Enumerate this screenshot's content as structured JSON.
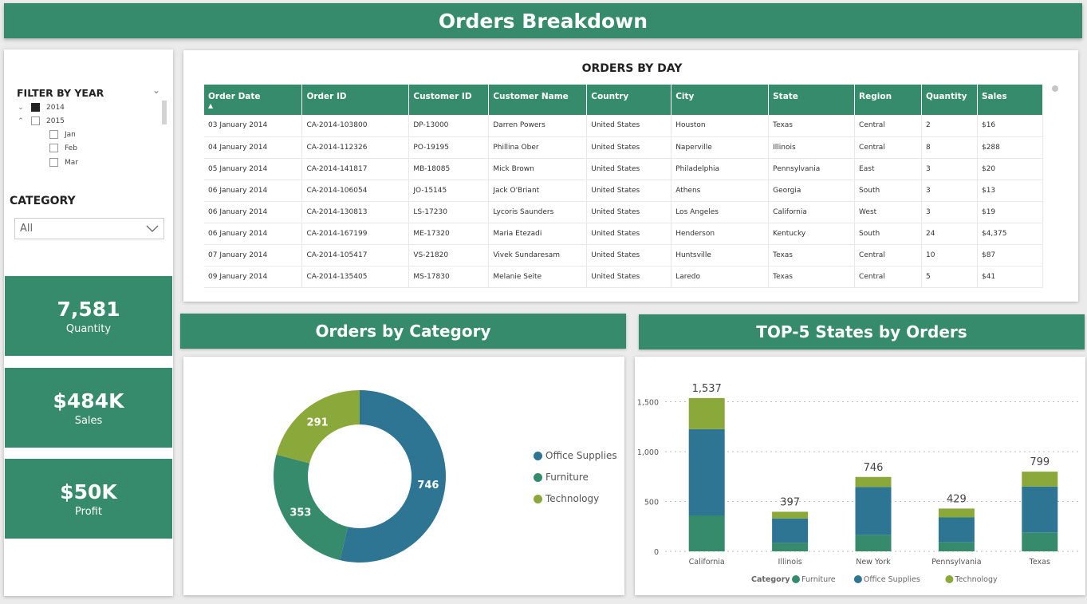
{
  "header": {
    "title": "Orders Breakdown"
  },
  "filters": {
    "year_title": "FILTER BY YEAR",
    "years": [
      {
        "label": "2014",
        "checked": true,
        "expanded": false
      },
      {
        "label": "2015",
        "checked": false,
        "expanded": true
      }
    ],
    "months": [
      "Jan",
      "Feb",
      "Mar"
    ],
    "category_title": "CATEGORY",
    "category_value": "All"
  },
  "kpis": [
    {
      "value": "7,581",
      "label": "Quantity"
    },
    {
      "value": "$484K",
      "label": "Sales"
    },
    {
      "value": "$50K",
      "label": "Profit"
    }
  ],
  "orders_table": {
    "title": "ORDERS BY DAY",
    "columns": [
      "Order Date",
      "Order ID",
      "Customer ID",
      "Customer Name",
      "Country",
      "City",
      "State",
      "Region",
      "Quantity",
      "Sales"
    ],
    "rows": [
      [
        "03 January 2014",
        "CA-2014-103800",
        "DP-13000",
        "Darren Powers",
        "United States",
        "Houston",
        "Texas",
        "Central",
        "2",
        "$16"
      ],
      [
        "04 January 2014",
        "CA-2014-112326",
        "PO-19195",
        "Phillina Ober",
        "United States",
        "Naperville",
        "Illinois",
        "Central",
        "8",
        "$288"
      ],
      [
        "05 January 2014",
        "CA-2014-141817",
        "MB-18085",
        "Mick Brown",
        "United States",
        "Philadelphia",
        "Pennsylvania",
        "East",
        "3",
        "$20"
      ],
      [
        "06 January 2014",
        "CA-2014-106054",
        "JO-15145",
        "Jack O'Briant",
        "United States",
        "Athens",
        "Georgia",
        "South",
        "3",
        "$13"
      ],
      [
        "06 January 2014",
        "CA-2014-130813",
        "LS-17230",
        "Lycoris Saunders",
        "United States",
        "Los Angeles",
        "California",
        "West",
        "3",
        "$19"
      ],
      [
        "06 January 2014",
        "CA-2014-167199",
        "ME-17320",
        "Maria Etezadi",
        "United States",
        "Henderson",
        "Kentucky",
        "South",
        "24",
        "$4,375"
      ],
      [
        "07 January 2014",
        "CA-2014-105417",
        "VS-21820",
        "Vivek Sundaresam",
        "United States",
        "Huntsville",
        "Texas",
        "Central",
        "10",
        "$87"
      ],
      [
        "09 January 2014",
        "CA-2014-135405",
        "MS-17830",
        "Melanie Seite",
        "United States",
        "Laredo",
        "Texas",
        "Central",
        "5",
        "$41"
      ]
    ]
  },
  "donut_title": "Orders by Category",
  "bar_title": "TOP-5 States by Orders",
  "colors": {
    "green": "#368b6c",
    "blue": "#2e7493",
    "olive": "#8aa93a"
  },
  "chart_data": [
    {
      "type": "pie",
      "title": "Orders by Category",
      "categories": [
        "Office Supplies",
        "Furniture",
        "Technology"
      ],
      "values": [
        746,
        353,
        291
      ]
    },
    {
      "type": "bar",
      "title": "TOP-5 States by Orders",
      "categories": [
        "California",
        "Illinois",
        "New York",
        "Pennsylvania",
        "Texas"
      ],
      "totals": [
        1537,
        397,
        746,
        429,
        799
      ],
      "legend_title": "Category",
      "series": [
        {
          "name": "Furniture",
          "values": [
            360,
            85,
            165,
            90,
            190
          ]
        },
        {
          "name": "Office Supplies",
          "values": [
            865,
            245,
            480,
            250,
            460
          ]
        },
        {
          "name": "Technology",
          "values": [
            312,
            67,
            101,
            89,
            149
          ]
        }
      ],
      "yticks": [
        "0",
        "500",
        "1,000",
        "1,500"
      ],
      "ylim": [
        0,
        1600
      ],
      "grid": true,
      "legend_position": "bottom"
    }
  ]
}
